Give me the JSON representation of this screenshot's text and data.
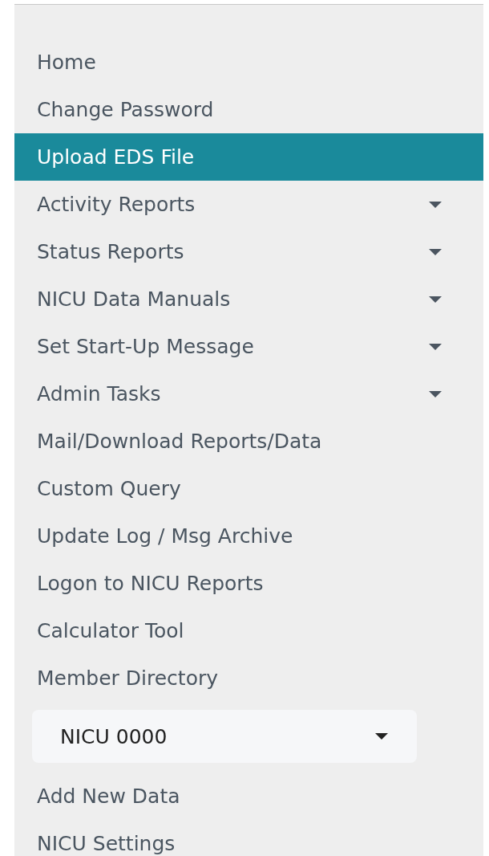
{
  "menu": [
    {
      "label": "Home",
      "selected": false,
      "kind": "link"
    },
    {
      "label": "Change Password",
      "selected": false,
      "kind": "link"
    },
    {
      "label": "Upload EDS File",
      "selected": true,
      "kind": "link"
    },
    {
      "label": "Activity Reports",
      "selected": false,
      "kind": "submenu"
    },
    {
      "label": "Status Reports",
      "selected": false,
      "kind": "submenu"
    },
    {
      "label": "NICU Data Manuals",
      "selected": false,
      "kind": "submenu"
    },
    {
      "label": "Set Start-Up Message",
      "selected": false,
      "kind": "submenu"
    },
    {
      "label": "Admin Tasks",
      "selected": false,
      "kind": "submenu"
    },
    {
      "label": "Mail/Download Reports/Data",
      "selected": false,
      "kind": "link"
    },
    {
      "label": "Custom Query",
      "selected": false,
      "kind": "link"
    },
    {
      "label": "Update Log / Msg Archive",
      "selected": false,
      "kind": "link"
    },
    {
      "label": "Logon to NICU Reports",
      "selected": false,
      "kind": "link"
    },
    {
      "label": "Calculator Tool",
      "selected": false,
      "kind": "link"
    },
    {
      "label": "Member Directory",
      "selected": false,
      "kind": "link"
    }
  ],
  "nicu_select": {
    "value": "NICU 0000"
  },
  "nicu_menu": [
    {
      "label": "Add New Data",
      "selected": false
    },
    {
      "label": "NICU Settings",
      "selected": false
    }
  ]
}
